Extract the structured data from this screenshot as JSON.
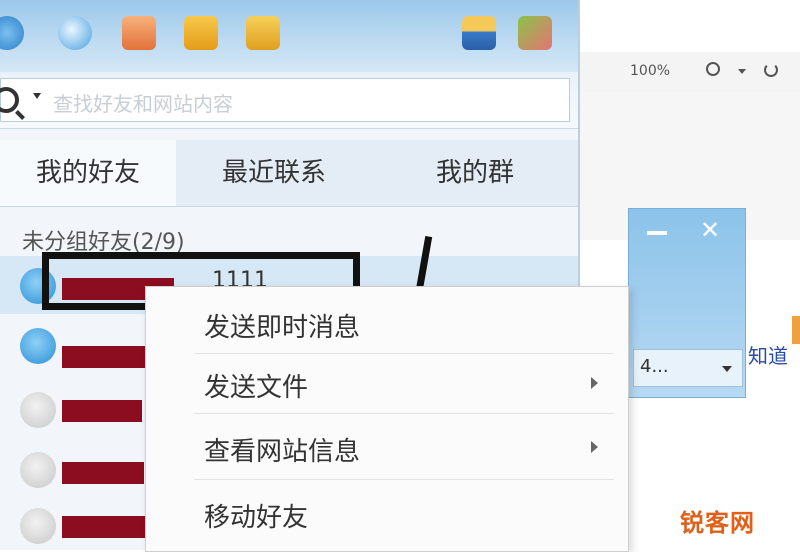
{
  "search": {
    "placeholder": "查找好友和网站内容"
  },
  "tabs": [
    {
      "label": "我的好友",
      "active": true
    },
    {
      "label": "最近联系",
      "active": false
    },
    {
      "label": "我的群",
      "active": false
    }
  ],
  "friend_list": {
    "group_header": "未分组好友(2/9)",
    "selected_text": "1111"
  },
  "context_menu": {
    "items": [
      {
        "label": "发送即时消息",
        "submenu": false
      },
      {
        "label": "发送文件",
        "submenu": true
      },
      {
        "label": "查看网站信息",
        "submenu": true
      },
      {
        "label": "移动好友",
        "submenu": false
      }
    ]
  },
  "browser": {
    "zoom_text": "100%"
  },
  "chat_window": {
    "input_text": "4..."
  },
  "right_link": "知道",
  "watermark": "锐客网",
  "colors": {
    "redaction": "#8b0d1f",
    "accent_blue": "#2a8fd8",
    "watermark": "#e0601a"
  }
}
